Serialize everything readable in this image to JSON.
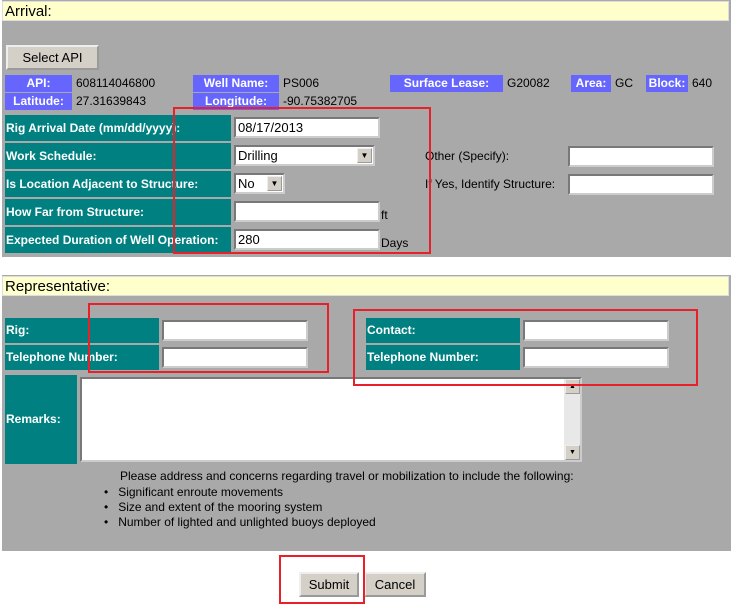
{
  "arrival": {
    "title": "Arrival:",
    "select_api": "Select API",
    "api_label": "API:",
    "api": "608114046800",
    "well_name_label": "Well Name:",
    "well_name": "PS006",
    "surface_lease_label": "Surface Lease:",
    "surface_lease": "G20082",
    "area_label": "Area:",
    "area": "GC",
    "block_label": "Block:",
    "block": "640",
    "latitude_label": "Latitude:",
    "latitude": "27.31639843",
    "longitude_label": "Longitude:",
    "longitude": "-90.75382705",
    "rig_arrival_label": "Rig Arrival Date (mm/dd/yyyy):",
    "rig_arrival": "08/17/2013",
    "work_schedule_label": "Work Schedule:",
    "work_schedule": "Drilling",
    "adjacent_label": "Is Location Adjacent to Structure:",
    "adjacent": "No",
    "how_far_label": "How Far from Structure:",
    "how_far": "",
    "how_far_unit": "ft",
    "duration_label": "Expected Duration of Well Operation:",
    "duration": "280",
    "duration_unit": "Days",
    "other_label": "Other (Specify):",
    "other": "",
    "identify_label": "If Yes, Identify Structure:",
    "identify": ""
  },
  "representative": {
    "title": "Representative:",
    "rig_label": "Rig:",
    "rig": "",
    "rig_phone_label": "Telephone Number:",
    "rig_phone": "",
    "contact_label": "Contact:",
    "contact": "",
    "contact_phone_label": "Telephone Number:",
    "contact_phone": "",
    "remarks_label": "Remarks:",
    "remarks": "",
    "note": "Please address and concerns regarding travel or mobilization to include the following:",
    "bullets": [
      "Significant enroute movements",
      "Size and extent of the mooring system",
      "Number of lighted and unlighted buoys deployed"
    ]
  },
  "actions": {
    "submit": "Submit",
    "cancel": "Cancel"
  }
}
